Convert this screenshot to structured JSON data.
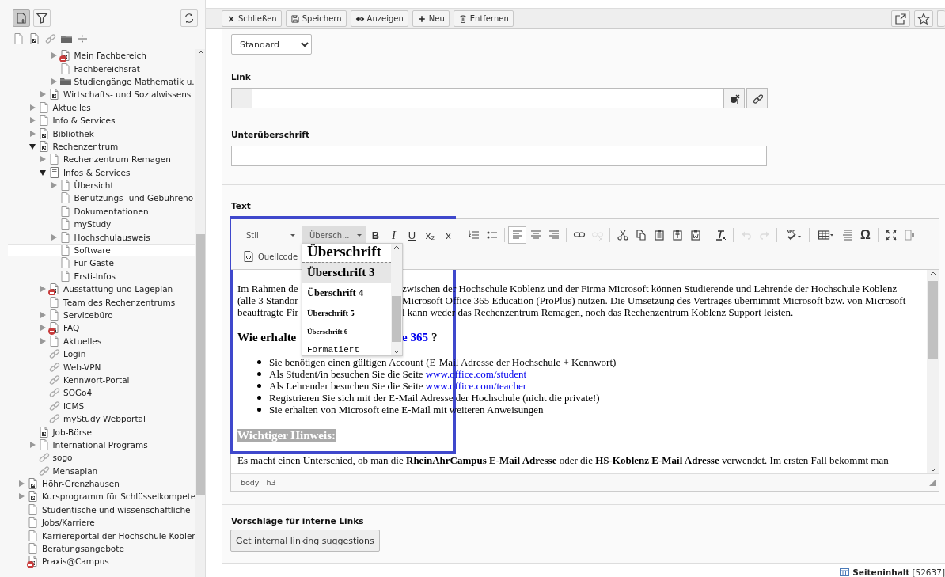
{
  "sidebar": {
    "toolbar": [
      {
        "kind": "new-page",
        "selected": true
      },
      {
        "kind": "filter",
        "selected": false
      }
    ],
    "page_types": [
      {
        "kind": "page"
      },
      {
        "kind": "shortcut"
      },
      {
        "kind": "link"
      },
      {
        "kind": "folder"
      },
      {
        "kind": "divider"
      }
    ],
    "tree": [
      {
        "children": [
          {
            "children": [
              {
                "children": [
                  {
                    "label": "Mein Fachbereich",
                    "kind": "shortcut",
                    "expandable": true,
                    "expanded": false,
                    "hidden": true,
                    "selected": false
                  },
                  {
                    "label": "Fachbereichsrat",
                    "kind": "page",
                    "expandable": false,
                    "hidden": false,
                    "selected": false
                  },
                  {
                    "label": "Studiengänge Mathematik u.",
                    "kind": "folder",
                    "expandable": true,
                    "expanded": false,
                    "hidden": false,
                    "selected": false
                  }
                ]
              },
              {
                "label": "Wirtschafts- und Sozialwissens",
                "kind": "shortcut",
                "expandable": true,
                "expanded": false,
                "hidden": false,
                "selected": false
              }
            ]
          },
          {
            "label": "Aktuelles",
            "kind": "page",
            "expandable": true,
            "expanded": false,
            "hidden": false,
            "selected": false
          },
          {
            "label": "Info & Services",
            "kind": "page",
            "expandable": true,
            "expanded": false,
            "hidden": false,
            "selected": false
          },
          {
            "label": "Bibliothek",
            "kind": "shortcut",
            "expandable": true,
            "expanded": false,
            "hidden": false,
            "selected": false
          },
          {
            "label": "Rechenzentrum",
            "kind": "shortcut",
            "expandable": true,
            "expanded": true,
            "hidden": false,
            "selected": false,
            "children": [
              {
                "label": "Rechenzentrum Remagen",
                "kind": "page",
                "expandable": true,
                "expanded": false,
                "hidden": false,
                "selected": false
              },
              {
                "label": "Infos & Services",
                "kind": "section",
                "expandable": true,
                "expanded": true,
                "hidden": false,
                "selected": false,
                "children": [
                  {
                    "label": "Übersicht",
                    "kind": "page",
                    "expandable": true,
                    "expanded": false,
                    "hidden": false,
                    "selected": false
                  },
                  {
                    "label": "Benutzungs- und Gebührenο",
                    "kind": "page",
                    "expandable": false,
                    "hidden": false,
                    "selected": false
                  },
                  {
                    "label": "Dokumentationen",
                    "kind": "page",
                    "expandable": false,
                    "hidden": false,
                    "selected": false
                  },
                  {
                    "label": "myStudy",
                    "kind": "page",
                    "expandable": false,
                    "hidden": false,
                    "selected": false
                  },
                  {
                    "label": "Hochschulausweis",
                    "kind": "page",
                    "expandable": true,
                    "expanded": false,
                    "hidden": false,
                    "selected": false
                  },
                  {
                    "label": "Software",
                    "kind": "page",
                    "expandable": false,
                    "hidden": false,
                    "selected": true
                  },
                  {
                    "label": "Für Gäste",
                    "kind": "page",
                    "expandable": false,
                    "hidden": false,
                    "selected": false
                  },
                  {
                    "label": "Ersti-Infos",
                    "kind": "page",
                    "expandable": false,
                    "hidden": false,
                    "selected": false
                  }
                ]
              },
              {
                "label": "Ausstattung und Lageplan",
                "kind": "shortcut",
                "expandable": true,
                "expanded": false,
                "hidden": true,
                "selected": false
              },
              {
                "label": "Team des Rechenzentrums",
                "kind": "page",
                "expandable": false,
                "hidden": false,
                "selected": false
              },
              {
                "label": "Servicebüro",
                "kind": "page",
                "expandable": true,
                "expanded": false,
                "hidden": false,
                "selected": false
              },
              {
                "label": "FAQ",
                "kind": "shortcut",
                "expandable": true,
                "expanded": false,
                "hidden": true,
                "selected": false
              },
              {
                "label": "Aktuelles",
                "kind": "page",
                "expandable": true,
                "expanded": false,
                "hidden": false,
                "selected": false
              },
              {
                "label": "Login",
                "kind": "link",
                "expandable": false,
                "hidden": false,
                "selected": false
              },
              {
                "label": "Web-VPN",
                "kind": "link",
                "expandable": false,
                "hidden": false,
                "selected": false
              },
              {
                "label": "Kennwort-Portal",
                "kind": "link",
                "expandable": false,
                "hidden": false,
                "selected": false
              },
              {
                "label": "SOGo4",
                "kind": "link",
                "expandable": false,
                "hidden": false,
                "selected": false
              },
              {
                "label": "ICMS",
                "kind": "link",
                "expandable": false,
                "hidden": false,
                "selected": false
              },
              {
                "label": "myStudy Webportal",
                "kind": "link",
                "expandable": false,
                "hidden": false,
                "selected": false
              }
            ]
          },
          {
            "label": "Job-Börse",
            "kind": "shortcut",
            "expandable": false,
            "hidden": false,
            "selected": false
          },
          {
            "label": "International Programs",
            "kind": "page",
            "expandable": true,
            "expanded": false,
            "hidden": false,
            "selected": false
          },
          {
            "label": "sogo",
            "kind": "link",
            "expandable": false,
            "hidden": false,
            "selected": false
          },
          {
            "label": "Mensaplan",
            "kind": "link",
            "expandable": false,
            "hidden": false,
            "selected": false
          }
        ]
      },
      {
        "label": "Höhr-Grenzhausen",
        "kind": "shortcut",
        "expandable": true,
        "expanded": false,
        "hidden": false,
        "selected": false
      },
      {
        "label": "Kursprogramm für Schlüsselkompete",
        "kind": "shortcut",
        "expandable": true,
        "expanded": false,
        "hidden": false,
        "selected": false
      },
      {
        "label": "Studentische und wissenschaftliche",
        "kind": "page",
        "expandable": false,
        "hidden": false,
        "selected": false
      },
      {
        "label": "Jobs/Karriere",
        "kind": "page",
        "expandable": false,
        "hidden": false,
        "selected": false
      },
      {
        "label": "Karriereportal der Hochschule Kobler",
        "kind": "page",
        "expandable": false,
        "hidden": false,
        "selected": false
      },
      {
        "label": "Beratungsangebote",
        "kind": "page",
        "expandable": false,
        "hidden": false,
        "selected": false
      },
      {
        "label": "Praxis@Campus",
        "kind": "shortcut",
        "expandable": false,
        "hidden": true,
        "selected": false
      }
    ]
  },
  "toolbar": {
    "buttons": [
      {
        "kind": "close",
        "label": "Schließen"
      },
      {
        "kind": "save",
        "label": "Speichern"
      },
      {
        "kind": "view",
        "label": "Anzeigen"
      },
      {
        "kind": "new",
        "label": "Neu"
      },
      {
        "kind": "delete",
        "label": "Entfernen"
      }
    ],
    "actions": [
      {
        "kind": "open-new"
      },
      {
        "kind": "bookmark"
      },
      {
        "kind": "more"
      }
    ]
  },
  "form": {
    "layout_select": {
      "value": "Standard"
    },
    "link_label": "Link",
    "subheader_label": "Unterüberschrift",
    "text_label": "Text",
    "editor": {
      "highlight_frame": true,
      "toolbar": [
        [
          {
            "kind": "combo",
            "text": "Stil",
            "open": false
          },
          {
            "kind": "combo",
            "text": "Übersch...",
            "open": true
          }
        ],
        [
          {
            "kind": "bold",
            "text": "B",
            "active": false,
            "disabled": false
          },
          {
            "kind": "italic",
            "text": "I",
            "active": false,
            "disabled": false
          },
          {
            "kind": "underline",
            "text": "U",
            "active": false,
            "disabled": false
          },
          {
            "kind": "subscript",
            "text": "x₂",
            "active": false,
            "disabled": false
          },
          {
            "kind": "superscript",
            "text": "x",
            "active": false,
            "disabled": false
          }
        ],
        [
          {
            "kind": "ordered-list",
            "active": false,
            "disabled": false
          },
          {
            "kind": "bullet-list",
            "active": false,
            "disabled": false
          }
        ],
        [
          {
            "kind": "align-left",
            "active": true,
            "disabled": false
          },
          {
            "kind": "align-center",
            "active": false,
            "disabled": false
          },
          {
            "kind": "align-right",
            "active": false,
            "disabled": false
          }
        ],
        [
          {
            "kind": "link",
            "active": false,
            "disabled": false
          },
          {
            "kind": "unlink",
            "active": false,
            "disabled": true
          }
        ],
        [
          {
            "kind": "cut",
            "active": false,
            "disabled": false
          },
          {
            "kind": "copy",
            "active": false,
            "disabled": false
          },
          {
            "kind": "paste",
            "active": false,
            "disabled": false
          },
          {
            "kind": "paste-text",
            "active": false,
            "disabled": false
          },
          {
            "kind": "paste-word",
            "active": false,
            "disabled": false
          }
        ],
        [
          {
            "kind": "remove-format",
            "active": false,
            "disabled": false
          }
        ],
        [
          {
            "kind": "undo",
            "active": false,
            "disabled": true
          },
          {
            "kind": "redo",
            "active": false,
            "disabled": true
          }
        ],
        [
          {
            "kind": "spellcheck",
            "active": false,
            "disabled": false
          }
        ],
        [
          {
            "kind": "table",
            "active": false,
            "disabled": false
          },
          {
            "kind": "horizontal-line",
            "active": false,
            "disabled": false
          },
          {
            "kind": "special-char",
            "text": "Ω",
            "active": false,
            "disabled": false
          }
        ],
        [
          {
            "kind": "maximize",
            "active": false,
            "disabled": false
          },
          {
            "kind": "show-blocks",
            "active": false,
            "disabled": false
          }
        ]
      ],
      "source_button": "Quellcode",
      "style_menu": [
        {
          "kind": "h2",
          "label": "Überschrift",
          "selected": false
        },
        {
          "kind": "h3",
          "label": "Überschrift 3",
          "selected": true
        },
        {
          "kind": "h4",
          "label": "Überschrift 4",
          "selected": false
        },
        {
          "kind": "h5",
          "label": "Überschrift 5",
          "selected": false
        },
        {
          "kind": "h6",
          "label": "Überschrift 6",
          "selected": false
        },
        {
          "kind": "pre",
          "label": "Formatiert",
          "selected": false
        }
      ],
      "content": [
        {
          "kind": "split",
          "left": "Im Rahmen de",
          "right": "zwischen der Hochschule Koblenz und der Firma Microsoft können Studierende und Lehrende der Hochschule Koblenz"
        },
        {
          "kind": "split",
          "left": "(alle 3 Standor",
          "right": "Microsoft Office 365 Education (ProPlus) nutzen. Die Umsetzung des Vertrages übernimmt Microsoft bzw. von Microsoft"
        },
        {
          "kind": "split",
          "left": "beauftragte Fir",
          "right": "l kann weder das Rechenzentrum Remagen, noch das Rechenzentrum Koblenz Support leisten."
        },
        {
          "kind": "heading-split",
          "left": "Wie erhalte",
          "link": "e 365",
          "right": "?"
        },
        {
          "kind": "list",
          "items": [
            {
              "text": "Sie benötigen einen gültigen Account (E-Mail Adresse der Hochschule + Kennwort)"
            },
            {
              "text": "Als Student/in besuchen Sie die Seite",
              "link": "www.office.com/student"
            },
            {
              "text": "Als Lehrender besuchen Sie die Seite",
              "link": "www.office.com/teacher"
            },
            {
              "text": "Registrieren Sie sich mit der E-Mail Adresse der Hochschule (nicht die private!)"
            },
            {
              "text": "Sie erhalten von Microsoft eine E-Mail mit weiteren Anweisungen"
            }
          ]
        },
        {
          "kind": "highlight-heading",
          "text": "Wichtiger Hinweis:"
        },
        {
          "kind": "paragraph",
          "text": "Es macht einen Unterschied, ob man die **RheinAhrCampus E-Mail Adresse** oder die **HS-Koblenz E-Mail Adresse** verwendet. Im ersten Fall bekommt man"
        }
      ],
      "path": [
        "body",
        "h3"
      ]
    },
    "suggestions": {
      "label": "Vorschläge für interne Links",
      "button": "Get internal linking suggestions"
    }
  },
  "footer": {
    "record": "Seiteninhalt",
    "id": "[52637]"
  }
}
